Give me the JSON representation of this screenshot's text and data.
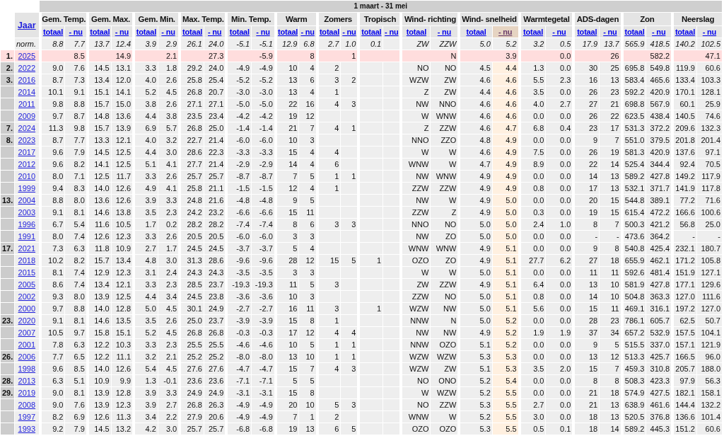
{
  "period": "1 maart - 31 mei",
  "year_header": "Jaar",
  "groups": [
    {
      "title": "Gem. Temp.",
      "subs": [
        {
          "label": "totaal",
          "selected": false
        },
        {
          "label": "- nu",
          "selected": false
        }
      ]
    },
    {
      "title": "Gem. Max.",
      "subs": [
        {
          "label": "totaal",
          "selected": false
        },
        {
          "label": "- nu",
          "selected": false
        }
      ]
    },
    {
      "title": "Gem. Min.",
      "subs": [
        {
          "label": "totaal",
          "selected": false
        },
        {
          "label": "- nu",
          "selected": false
        }
      ]
    },
    {
      "title": "Max. Temp.",
      "subs": [
        {
          "label": "totaal",
          "selected": false
        },
        {
          "label": "- nu",
          "selected": false
        }
      ]
    },
    {
      "title": "Min. Temp.",
      "subs": [
        {
          "label": "totaal",
          "selected": false
        },
        {
          "label": "- nu",
          "selected": false
        }
      ]
    },
    {
      "title": "Warm",
      "subs": [
        {
          "label": "totaal",
          "selected": false
        },
        {
          "label": "- nu",
          "selected": false
        }
      ]
    },
    {
      "title": "Zomers",
      "subs": [
        {
          "label": "totaal",
          "selected": false
        },
        {
          "label": "- nu",
          "selected": false
        }
      ]
    },
    {
      "title": "Tropisch",
      "subs": [
        {
          "label": "totaal",
          "selected": false
        },
        {
          "label": "- nu",
          "selected": false
        }
      ]
    },
    {
      "title": "Wind- richting",
      "subs": [
        {
          "label": "totaal",
          "selected": false
        },
        {
          "label": "- nu",
          "selected": false
        }
      ]
    },
    {
      "title": "Wind- snelheid",
      "subs": [
        {
          "label": "totaal",
          "selected": false
        },
        {
          "label": "- nu",
          "selected": true
        }
      ]
    },
    {
      "title": "Warmtegetal",
      "subs": [
        {
          "label": "totaal",
          "selected": false
        },
        {
          "label": "- nu",
          "selected": false
        }
      ]
    },
    {
      "title": "ADS-dagen",
      "subs": [
        {
          "label": "totaal",
          "selected": false
        },
        {
          "label": "- nu",
          "selected": false
        }
      ]
    },
    {
      "title": "Zon",
      "subs": [
        {
          "label": "totaal",
          "selected": false
        },
        {
          "label": "- nu",
          "selected": false
        }
      ]
    },
    {
      "title": "Neerslag",
      "subs": [
        {
          "label": "totaal",
          "selected": false
        },
        {
          "label": "- nu",
          "selected": false
        }
      ]
    }
  ],
  "norm": {
    "label": "norm.",
    "gem_temp": [
      "8.8",
      "7.7"
    ],
    "gem_max": [
      "13.7",
      "12.4"
    ],
    "gem_min": [
      "3.9",
      "2.9"
    ],
    "max_temp": [
      "26.1",
      "24.0"
    ],
    "min_temp": [
      "-5.1",
      "-5.1"
    ],
    "warm": [
      "12.9",
      "6.8"
    ],
    "zomers": [
      "2.7",
      "1.0"
    ],
    "tropisch": [
      "0.1"
    ],
    "wind_richting": [
      "ZW",
      "ZZW"
    ],
    "wind_snelheid": [
      "5.0",
      "5.2"
    ],
    "warmtegetal": [
      "3.2",
      "0.5"
    ],
    "ads_dagen": [
      "17.9",
      "13.7"
    ],
    "zon": [
      "565.9",
      "418.5"
    ],
    "neerslag": [
      "140.2",
      "102.5"
    ]
  },
  "rows": [
    {
      "rank": "1.",
      "year": "2025",
      "current": true,
      "gem_temp": [
        "8.5"
      ],
      "gem_max": [
        "14.9"
      ],
      "gem_min": [
        "2.1"
      ],
      "max_temp": [
        "27.3"
      ],
      "min_temp": [
        "-5.9"
      ],
      "warm": [
        "8"
      ],
      "zomers": [
        "1"
      ],
      "wind_richting": [
        "N"
      ],
      "wind_snelheid": [
        "3.9"
      ],
      "warmtegetal": [
        "0.0"
      ],
      "ads_dagen": [
        "26"
      ],
      "zon": [
        "582.2"
      ],
      "neerslag": [
        "47.1"
      ]
    },
    {
      "rank": "2.",
      "year": "2022",
      "current": false,
      "gem_temp": [
        "9.0",
        "7.6"
      ],
      "gem_max": [
        "14.5",
        "13.1"
      ],
      "gem_min": [
        "3.3",
        "1.8"
      ],
      "max_temp": [
        "29.2",
        "24.0"
      ],
      "min_temp": [
        "-4.9",
        "-4.9"
      ],
      "warm": [
        "10",
        "4"
      ],
      "zomers": [
        "2"
      ],
      "wind_richting": [
        "NO",
        "NO"
      ],
      "wind_snelheid": [
        "4.5",
        "4.4"
      ],
      "warmtegetal": [
        "1.3",
        "0.0"
      ],
      "ads_dagen": [
        "30",
        "25"
      ],
      "zon": [
        "695.8",
        "549.8"
      ],
      "neerslag": [
        "119.9",
        "60.6"
      ]
    },
    {
      "rank": "3.",
      "year": "2016",
      "current": false,
      "gem_temp": [
        "8.7",
        "7.3"
      ],
      "gem_max": [
        "13.4",
        "12.0"
      ],
      "gem_min": [
        "4.0",
        "2.6"
      ],
      "max_temp": [
        "25.8",
        "25.4"
      ],
      "min_temp": [
        "-5.2",
        "-5.2"
      ],
      "warm": [
        "13",
        "6"
      ],
      "zomers": [
        "3",
        "2"
      ],
      "wind_richting": [
        "WZW",
        "ZW"
      ],
      "wind_snelheid": [
        "4.6",
        "4.6"
      ],
      "warmtegetal": [
        "5.5",
        "2.3"
      ],
      "ads_dagen": [
        "16",
        "13"
      ],
      "zon": [
        "583.4",
        "465.6"
      ],
      "neerslag": [
        "133.4",
        "103.3"
      ]
    },
    {
      "year": "2014",
      "current": false,
      "gem_temp": [
        "10.1",
        "9.1"
      ],
      "gem_max": [
        "15.1",
        "14.1"
      ],
      "gem_min": [
        "5.2",
        "4.5"
      ],
      "max_temp": [
        "26.8",
        "20.7"
      ],
      "min_temp": [
        "-3.0",
        "-3.0"
      ],
      "warm": [
        "13",
        "4"
      ],
      "zomers": [
        "1"
      ],
      "wind_richting": [
        "Z",
        "ZW"
      ],
      "wind_snelheid": [
        "4.4",
        "4.6"
      ],
      "warmtegetal": [
        "3.5",
        "0.0"
      ],
      "ads_dagen": [
        "26",
        "23"
      ],
      "zon": [
        "592.2",
        "420.9"
      ],
      "neerslag": [
        "170.1",
        "128.1"
      ]
    },
    {
      "year": "2011",
      "current": false,
      "gem_temp": [
        "9.8",
        "8.8"
      ],
      "gem_max": [
        "15.7",
        "15.0"
      ],
      "gem_min": [
        "3.8",
        "2.6"
      ],
      "max_temp": [
        "27.1",
        "27.1"
      ],
      "min_temp": [
        "-5.0",
        "-5.0"
      ],
      "warm": [
        "22",
        "16"
      ],
      "zomers": [
        "4",
        "3"
      ],
      "wind_richting": [
        "NW",
        "NNO"
      ],
      "wind_snelheid": [
        "4.6",
        "4.6"
      ],
      "warmtegetal": [
        "4.0",
        "2.7"
      ],
      "ads_dagen": [
        "27",
        "21"
      ],
      "zon": [
        "698.8",
        "567.9"
      ],
      "neerslag": [
        "60.1",
        "25.9"
      ]
    },
    {
      "year": "2009",
      "current": false,
      "gem_temp": [
        "9.7",
        "8.7"
      ],
      "gem_max": [
        "14.8",
        "13.6"
      ],
      "gem_min": [
        "4.4",
        "3.8"
      ],
      "max_temp": [
        "23.5",
        "23.4"
      ],
      "min_temp": [
        "-4.2",
        "-4.2"
      ],
      "warm": [
        "19",
        "12"
      ],
      "wind_richting": [
        "W",
        "WNW"
      ],
      "wind_snelheid": [
        "4.6",
        "4.6"
      ],
      "warmtegetal": [
        "0.0",
        "0.0"
      ],
      "ads_dagen": [
        "26",
        "22"
      ],
      "zon": [
        "623.5",
        "438.4"
      ],
      "neerslag": [
        "140.5",
        "74.6"
      ]
    },
    {
      "rank": "7.",
      "year": "2024",
      "current": false,
      "gem_temp": [
        "11.3",
        "9.8"
      ],
      "gem_max": [
        "15.7",
        "13.9"
      ],
      "gem_min": [
        "6.9",
        "5.7"
      ],
      "max_temp": [
        "26.8",
        "25.0"
      ],
      "min_temp": [
        "-1.4",
        "-1.4"
      ],
      "warm": [
        "21",
        "7"
      ],
      "zomers": [
        "4",
        "1"
      ],
      "wind_richting": [
        "Z",
        "ZZW"
      ],
      "wind_snelheid": [
        "4.6",
        "4.7"
      ],
      "warmtegetal": [
        "6.8",
        "0.4"
      ],
      "ads_dagen": [
        "23",
        "17"
      ],
      "zon": [
        "531.3",
        "372.2"
      ],
      "neerslag": [
        "209.6",
        "132.3"
      ]
    },
    {
      "rank": "8.",
      "year": "2023",
      "current": false,
      "gem_temp": [
        "8.7",
        "7.7"
      ],
      "gem_max": [
        "13.3",
        "12.1"
      ],
      "gem_min": [
        "4.0",
        "3.2"
      ],
      "max_temp": [
        "22.7",
        "21.4"
      ],
      "min_temp": [
        "-6.0",
        "-6.0"
      ],
      "warm": [
        "10",
        "3"
      ],
      "wind_richting": [
        "NNO",
        "ZZO"
      ],
      "wind_snelheid": [
        "4.8",
        "4.9"
      ],
      "warmtegetal": [
        "0.0",
        "0.0"
      ],
      "ads_dagen": [
        "9",
        "7"
      ],
      "zon": [
        "551.0",
        "379.5"
      ],
      "neerslag": [
        "201.8",
        "201.4"
      ]
    },
    {
      "year": "2017",
      "current": false,
      "gem_temp": [
        "9.6",
        "7.9"
      ],
      "gem_max": [
        "14.5",
        "12.5"
      ],
      "gem_min": [
        "4.4",
        "3.0"
      ],
      "max_temp": [
        "28.6",
        "22.3"
      ],
      "min_temp": [
        "-3.3",
        "-3.3"
      ],
      "warm": [
        "15",
        "4"
      ],
      "zomers": [
        "4"
      ],
      "wind_richting": [
        "W",
        "W"
      ],
      "wind_snelheid": [
        "4.6",
        "4.9"
      ],
      "warmtegetal": [
        "7.5",
        "0.0"
      ],
      "ads_dagen": [
        "26",
        "19"
      ],
      "zon": [
        "581.3",
        "420.9"
      ],
      "neerslag": [
        "137.6",
        "97.1"
      ]
    },
    {
      "year": "2012",
      "current": false,
      "gem_temp": [
        "9.6",
        "8.2"
      ],
      "gem_max": [
        "14.1",
        "12.5"
      ],
      "gem_min": [
        "5.1",
        "4.1"
      ],
      "max_temp": [
        "27.7",
        "21.4"
      ],
      "min_temp": [
        "-2.9",
        "-2.9"
      ],
      "warm": [
        "14",
        "4"
      ],
      "zomers": [
        "6"
      ],
      "wind_richting": [
        "WNW",
        "W"
      ],
      "wind_snelheid": [
        "4.7",
        "4.9"
      ],
      "warmtegetal": [
        "8.9",
        "0.0"
      ],
      "ads_dagen": [
        "22",
        "14"
      ],
      "zon": [
        "525.4",
        "344.4"
      ],
      "neerslag": [
        "92.4",
        "70.5"
      ]
    },
    {
      "year": "2010",
      "current": false,
      "gem_temp": [
        "8.0",
        "7.1"
      ],
      "gem_max": [
        "12.5",
        "11.7"
      ],
      "gem_min": [
        "3.3",
        "2.6"
      ],
      "max_temp": [
        "25.7",
        "25.7"
      ],
      "min_temp": [
        "-8.7",
        "-8.7"
      ],
      "warm": [
        "7",
        "5"
      ],
      "zomers": [
        "1",
        "1"
      ],
      "wind_richting": [
        "NW",
        "WNW"
      ],
      "wind_snelheid": [
        "4.9",
        "4.9"
      ],
      "warmtegetal": [
        "0.0",
        "0.0"
      ],
      "ads_dagen": [
        "14",
        "13"
      ],
      "zon": [
        "589.2",
        "427.8"
      ],
      "neerslag": [
        "149.2",
        "117.9"
      ]
    },
    {
      "year": "1999",
      "current": false,
      "gem_temp": [
        "9.4",
        "8.3"
      ],
      "gem_max": [
        "14.0",
        "12.6"
      ],
      "gem_min": [
        "4.9",
        "4.1"
      ],
      "max_temp": [
        "25.8",
        "21.1"
      ],
      "min_temp": [
        "-1.5",
        "-1.5"
      ],
      "warm": [
        "12",
        "4"
      ],
      "zomers": [
        "1"
      ],
      "wind_richting": [
        "ZZW",
        "ZZW"
      ],
      "wind_snelheid": [
        "4.9",
        "4.9"
      ],
      "warmtegetal": [
        "0.8",
        "0.0"
      ],
      "ads_dagen": [
        "17",
        "13"
      ],
      "zon": [
        "532.1",
        "371.7"
      ],
      "neerslag": [
        "141.9",
        "117.8"
      ]
    },
    {
      "rank": "13.",
      "year": "2004",
      "current": false,
      "gem_temp": [
        "8.8",
        "8.0"
      ],
      "gem_max": [
        "13.6",
        "12.6"
      ],
      "gem_min": [
        "3.9",
        "3.3"
      ],
      "max_temp": [
        "24.8",
        "21.6"
      ],
      "min_temp": [
        "-4.8",
        "-4.8"
      ],
      "warm": [
        "9",
        "5"
      ],
      "wind_richting": [
        "NW",
        "W"
      ],
      "wind_snelheid": [
        "4.9",
        "5.0"
      ],
      "warmtegetal": [
        "0.0",
        "0.0"
      ],
      "ads_dagen": [
        "20",
        "15"
      ],
      "zon": [
        "544.8",
        "389.1"
      ],
      "neerslag": [
        "77.2",
        "71.6"
      ]
    },
    {
      "year": "2003",
      "current": false,
      "gem_temp": [
        "9.1",
        "8.1"
      ],
      "gem_max": [
        "14.6",
        "13.8"
      ],
      "gem_min": [
        "3.5",
        "2.3"
      ],
      "max_temp": [
        "24.2",
        "23.2"
      ],
      "min_temp": [
        "-6.6",
        "-6.6"
      ],
      "warm": [
        "15",
        "11"
      ],
      "wind_richting": [
        "ZZW",
        "Z"
      ],
      "wind_snelheid": [
        "4.9",
        "5.0"
      ],
      "warmtegetal": [
        "0.3",
        "0.0"
      ],
      "ads_dagen": [
        "19",
        "15"
      ],
      "zon": [
        "615.4",
        "472.2"
      ],
      "neerslag": [
        "166.6",
        "100.6"
      ]
    },
    {
      "year": "1996",
      "current": false,
      "gem_temp": [
        "6.7",
        "5.4"
      ],
      "gem_max": [
        "11.6",
        "10.5"
      ],
      "gem_min": [
        "1.7",
        "0.2"
      ],
      "max_temp": [
        "28.2",
        "28.2"
      ],
      "min_temp": [
        "-7.4",
        "-7.4"
      ],
      "warm": [
        "8",
        "6"
      ],
      "zomers": [
        "3",
        "3"
      ],
      "wind_richting": [
        "NNO",
        "NO"
      ],
      "wind_snelheid": [
        "5.0",
        "5.0"
      ],
      "warmtegetal": [
        "2.4",
        "1.0"
      ],
      "ads_dagen": [
        "8",
        "7"
      ],
      "zon": [
        "500.3",
        "421.2"
      ],
      "neerslag": [
        "56.8",
        "25.0"
      ]
    },
    {
      "year": "1991",
      "current": false,
      "gem_temp": [
        "8.0",
        "7.4"
      ],
      "gem_max": [
        "12.6",
        "12.3"
      ],
      "gem_min": [
        "3.3",
        "2.6"
      ],
      "max_temp": [
        "20.5",
        "20.5"
      ],
      "min_temp": [
        "-6.0",
        "-6.0"
      ],
      "warm": [
        "3",
        "3"
      ],
      "wind_richting": [
        "NW",
        "ZO"
      ],
      "wind_snelheid": [
        "5.0",
        "5.0"
      ],
      "warmtegetal": [
        "0.0",
        "0.0"
      ],
      "ads_dagen": [
        "-",
        "-"
      ],
      "zon": [
        "473.6",
        "364.2"
      ],
      "neerslag": [
        "-",
        "-"
      ]
    },
    {
      "rank": "17.",
      "year": "2021",
      "current": false,
      "gem_temp": [
        "7.3",
        "6.3"
      ],
      "gem_max": [
        "11.8",
        "10.9"
      ],
      "gem_min": [
        "2.7",
        "1.7"
      ],
      "max_temp": [
        "24.5",
        "24.5"
      ],
      "min_temp": [
        "-3.7",
        "-3.7"
      ],
      "warm": [
        "5",
        "4"
      ],
      "wind_richting": [
        "WNW",
        "WNW"
      ],
      "wind_snelheid": [
        "4.9",
        "5.1"
      ],
      "warmtegetal": [
        "0.0",
        "0.0"
      ],
      "ads_dagen": [
        "9",
        "8"
      ],
      "zon": [
        "540.8",
        "425.4"
      ],
      "neerslag": [
        "232.1",
        "180.7"
      ]
    },
    {
      "year": "2018",
      "current": false,
      "gem_temp": [
        "10.2",
        "8.2"
      ],
      "gem_max": [
        "15.7",
        "13.4"
      ],
      "gem_min": [
        "4.8",
        "3.0"
      ],
      "max_temp": [
        "31.3",
        "28.6"
      ],
      "min_temp": [
        "-9.6",
        "-9.6"
      ],
      "warm": [
        "28",
        "12"
      ],
      "zomers": [
        "15",
        "5"
      ],
      "tropisch": [
        "1"
      ],
      "wind_richting": [
        "OZO",
        "ZO"
      ],
      "wind_snelheid": [
        "4.9",
        "5.1"
      ],
      "warmtegetal": [
        "27.7",
        "6.2"
      ],
      "ads_dagen": [
        "27",
        "18"
      ],
      "zon": [
        "655.9",
        "462.1"
      ],
      "neerslag": [
        "171.2",
        "105.8"
      ]
    },
    {
      "year": "2015",
      "current": false,
      "gem_temp": [
        "8.1",
        "7.4"
      ],
      "gem_max": [
        "12.9",
        "12.3"
      ],
      "gem_min": [
        "3.1",
        "2.4"
      ],
      "max_temp": [
        "24.3",
        "24.3"
      ],
      "min_temp": [
        "-3.5",
        "-3.5"
      ],
      "warm": [
        "3",
        "3"
      ],
      "wind_richting": [
        "W",
        "W"
      ],
      "wind_snelheid": [
        "5.0",
        "5.1"
      ],
      "warmtegetal": [
        "0.0",
        "0.0"
      ],
      "ads_dagen": [
        "11",
        "11"
      ],
      "zon": [
        "592.6",
        "481.4"
      ],
      "neerslag": [
        "151.9",
        "127.1"
      ]
    },
    {
      "year": "2005",
      "current": false,
      "gem_temp": [
        "8.6",
        "7.4"
      ],
      "gem_max": [
        "13.4",
        "12.1"
      ],
      "gem_min": [
        "3.3",
        "2.3"
      ],
      "max_temp": [
        "28.5",
        "23.7"
      ],
      "min_temp": [
        "-19.3",
        "-19.3"
      ],
      "warm": [
        "11",
        "5"
      ],
      "zomers": [
        "3"
      ],
      "wind_richting": [
        "ZW",
        "ZZW"
      ],
      "wind_snelheid": [
        "4.9",
        "5.1"
      ],
      "warmtegetal": [
        "6.4",
        "0.0"
      ],
      "ads_dagen": [
        "13",
        "10"
      ],
      "zon": [
        "581.9",
        "427.8"
      ],
      "neerslag": [
        "177.1",
        "129.6"
      ]
    },
    {
      "year": "2002",
      "current": false,
      "gem_temp": [
        "9.3",
        "8.0"
      ],
      "gem_max": [
        "13.9",
        "12.5"
      ],
      "gem_min": [
        "4.4",
        "3.4"
      ],
      "max_temp": [
        "24.5",
        "23.8"
      ],
      "min_temp": [
        "-3.6",
        "-3.6"
      ],
      "warm": [
        "10",
        "3"
      ],
      "wind_richting": [
        "ZZW",
        "NO"
      ],
      "wind_snelheid": [
        "5.0",
        "5.1"
      ],
      "warmtegetal": [
        "0.8",
        "0.0"
      ],
      "ads_dagen": [
        "14",
        "10"
      ],
      "zon": [
        "504.8",
        "363.3"
      ],
      "neerslag": [
        "127.0",
        "111.6"
      ]
    },
    {
      "year": "2000",
      "current": false,
      "gem_temp": [
        "9.7",
        "8.8"
      ],
      "gem_max": [
        "14.0",
        "12.8"
      ],
      "gem_min": [
        "5.0",
        "4.5"
      ],
      "max_temp": [
        "30.1",
        "24.9"
      ],
      "min_temp": [
        "-2.7",
        "-2.7"
      ],
      "warm": [
        "16",
        "11"
      ],
      "zomers": [
        "3"
      ],
      "tropisch": [
        "1"
      ],
      "wind_richting": [
        "WZW",
        "NW"
      ],
      "wind_snelheid": [
        "5.0",
        "5.1"
      ],
      "warmtegetal": [
        "5.6",
        "0.0"
      ],
      "ads_dagen": [
        "15",
        "11"
      ],
      "zon": [
        "469.1",
        "316.1"
      ],
      "neerslag": [
        "197.2",
        "127.0"
      ]
    },
    {
      "rank": "23.",
      "year": "2020",
      "current": false,
      "gem_temp": [
        "9.1",
        "8.1"
      ],
      "gem_max": [
        "14.6",
        "13.5"
      ],
      "gem_min": [
        "3.5",
        "2.6"
      ],
      "max_temp": [
        "25.0",
        "23.7"
      ],
      "min_temp": [
        "-3.9",
        "-3.9"
      ],
      "warm": [
        "15",
        "8"
      ],
      "zomers": [
        "1"
      ],
      "wind_richting": [
        "NNW",
        "N"
      ],
      "wind_snelheid": [
        "5.0",
        "5.2"
      ],
      "warmtegetal": [
        "0.0",
        "0.0"
      ],
      "ads_dagen": [
        "28",
        "23"
      ],
      "zon": [
        "786.1",
        "605.7"
      ],
      "neerslag": [
        "62.5",
        "50.7"
      ]
    },
    {
      "year": "2007",
      "current": false,
      "gem_temp": [
        "10.5",
        "9.7"
      ],
      "gem_max": [
        "15.8",
        "15.1"
      ],
      "gem_min": [
        "5.2",
        "4.5"
      ],
      "max_temp": [
        "26.8",
        "26.8"
      ],
      "min_temp": [
        "-0.3",
        "-0.3"
      ],
      "warm": [
        "17",
        "12"
      ],
      "zomers": [
        "4",
        "4"
      ],
      "wind_richting": [
        "NW",
        "NW"
      ],
      "wind_snelheid": [
        "4.9",
        "5.2"
      ],
      "warmtegetal": [
        "1.9",
        "1.9"
      ],
      "ads_dagen": [
        "37",
        "34"
      ],
      "zon": [
        "657.2",
        "532.9"
      ],
      "neerslag": [
        "157.5",
        "104.1"
      ]
    },
    {
      "year": "2001",
      "current": false,
      "gem_temp": [
        "7.8",
        "6.3"
      ],
      "gem_max": [
        "12.2",
        "10.3"
      ],
      "gem_min": [
        "3.3",
        "2.3"
      ],
      "max_temp": [
        "25.5",
        "25.5"
      ],
      "min_temp": [
        "-4.6",
        "-4.6"
      ],
      "warm": [
        "10",
        "5"
      ],
      "zomers": [
        "1",
        "1"
      ],
      "wind_richting": [
        "NNW",
        "OZO"
      ],
      "wind_snelheid": [
        "5.1",
        "5.2"
      ],
      "warmtegetal": [
        "0.0",
        "0.0"
      ],
      "ads_dagen": [
        "9",
        "5"
      ],
      "zon": [
        "515.5",
        "337.0"
      ],
      "neerslag": [
        "157.1",
        "121.9"
      ]
    },
    {
      "rank": "26.",
      "year": "2006",
      "current": false,
      "gem_temp": [
        "7.7",
        "6.5"
      ],
      "gem_max": [
        "12.2",
        "11.1"
      ],
      "gem_min": [
        "3.2",
        "2.1"
      ],
      "max_temp": [
        "25.2",
        "25.2"
      ],
      "min_temp": [
        "-8.0",
        "-8.0"
      ],
      "warm": [
        "13",
        "10"
      ],
      "zomers": [
        "1",
        "1"
      ],
      "wind_richting": [
        "WZW",
        "WZW"
      ],
      "wind_snelheid": [
        "5.3",
        "5.3"
      ],
      "warmtegetal": [
        "0.0",
        "0.0"
      ],
      "ads_dagen": [
        "13",
        "12"
      ],
      "zon": [
        "513.3",
        "425.7"
      ],
      "neerslag": [
        "166.5",
        "96.0"
      ]
    },
    {
      "year": "1998",
      "current": false,
      "gem_temp": [
        "9.6",
        "8.5"
      ],
      "gem_max": [
        "14.0",
        "12.6"
      ],
      "gem_min": [
        "5.4",
        "4.5"
      ],
      "max_temp": [
        "27.6",
        "27.6"
      ],
      "min_temp": [
        "-4.7",
        "-4.7"
      ],
      "warm": [
        "15",
        "7"
      ],
      "zomers": [
        "4",
        "3"
      ],
      "wind_richting": [
        "WZW",
        "ZW"
      ],
      "wind_snelheid": [
        "5.1",
        "5.3"
      ],
      "warmtegetal": [
        "3.5",
        "2.0"
      ],
      "ads_dagen": [
        "15",
        "7"
      ],
      "zon": [
        "459.3",
        "310.8"
      ],
      "neerslag": [
        "205.7",
        "188.0"
      ]
    },
    {
      "rank": "28.",
      "year": "2013",
      "current": false,
      "gem_temp": [
        "6.3",
        "5.1"
      ],
      "gem_max": [
        "10.9",
        "9.9"
      ],
      "gem_min": [
        "1.3",
        "-0.1"
      ],
      "max_temp": [
        "23.6",
        "23.6"
      ],
      "min_temp": [
        "-7.1",
        "-7.1"
      ],
      "warm": [
        "5",
        "5"
      ],
      "wind_richting": [
        "NO",
        "ONO"
      ],
      "wind_snelheid": [
        "5.2",
        "5.4"
      ],
      "warmtegetal": [
        "0.0",
        "0.0"
      ],
      "ads_dagen": [
        "8",
        "8"
      ],
      "zon": [
        "508.3",
        "423.3"
      ],
      "neerslag": [
        "97.9",
        "56.3"
      ]
    },
    {
      "rank": "29.",
      "year": "2019",
      "current": false,
      "gem_temp": [
        "9.0",
        "8.1"
      ],
      "gem_max": [
        "13.9",
        "12.8"
      ],
      "gem_min": [
        "3.9",
        "3.3"
      ],
      "max_temp": [
        "24.9",
        "24.9"
      ],
      "min_temp": [
        "-3.1",
        "-3.1"
      ],
      "warm": [
        "15",
        "8"
      ],
      "wind_richting": [
        "W",
        "WZW"
      ],
      "wind_snelheid": [
        "5.2",
        "5.5"
      ],
      "warmtegetal": [
        "0.0",
        "0.0"
      ],
      "ads_dagen": [
        "21",
        "18"
      ],
      "zon": [
        "574.9",
        "427.5"
      ],
      "neerslag": [
        "182.1",
        "158.1"
      ]
    },
    {
      "year": "2008",
      "current": false,
      "gem_temp": [
        "9.0",
        "7.6"
      ],
      "gem_max": [
        "13.9",
        "12.3"
      ],
      "gem_min": [
        "3.9",
        "2.7"
      ],
      "max_temp": [
        "26.8",
        "26.3"
      ],
      "min_temp": [
        "-4.9",
        "-4.9"
      ],
      "warm": [
        "20",
        "10"
      ],
      "zomers": [
        "5",
        "3"
      ],
      "wind_richting": [
        "NO",
        "ZZW"
      ],
      "wind_snelheid": [
        "5.3",
        "5.5"
      ],
      "warmtegetal": [
        "2.7",
        "0.0"
      ],
      "ads_dagen": [
        "21",
        "13"
      ],
      "zon": [
        "638.9",
        "461.6"
      ],
      "neerslag": [
        "144.4",
        "132.2"
      ]
    },
    {
      "year": "1997",
      "current": false,
      "gem_temp": [
        "8.2",
        "6.9"
      ],
      "gem_max": [
        "12.6",
        "11.3"
      ],
      "gem_min": [
        "3.4",
        "2.2"
      ],
      "max_temp": [
        "27.9",
        "20.6"
      ],
      "min_temp": [
        "-4.9",
        "-4.9"
      ],
      "warm": [
        "7",
        "1"
      ],
      "zomers": [
        "2"
      ],
      "wind_richting": [
        "WNW",
        "W"
      ],
      "wind_snelheid": [
        "5.2",
        "5.5"
      ],
      "warmtegetal": [
        "3.0",
        "0.0"
      ],
      "ads_dagen": [
        "18",
        "13"
      ],
      "zon": [
        "520.5",
        "376.8"
      ],
      "neerslag": [
        "136.6",
        "101.4"
      ]
    },
    {
      "year": "1993",
      "current": false,
      "gem_temp": [
        "9.2",
        "7.9"
      ],
      "gem_max": [
        "14.5",
        "13.2"
      ],
      "gem_min": [
        "4.2",
        "3.0"
      ],
      "max_temp": [
        "25.7",
        "25.7"
      ],
      "min_temp": [
        "-6.8",
        "-6.8"
      ],
      "warm": [
        "19",
        "13"
      ],
      "zomers": [
        "6",
        "5"
      ],
      "wind_richting": [
        "OZO",
        "OZO"
      ],
      "wind_snelheid": [
        "5.3",
        "5.5"
      ],
      "warmtegetal": [
        "0.5",
        "0.1"
      ],
      "ads_dagen": [
        "18",
        "14"
      ],
      "zon": [
        "589.2",
        "445.3"
      ],
      "neerslag": [
        "151.2",
        "60.6"
      ]
    }
  ]
}
